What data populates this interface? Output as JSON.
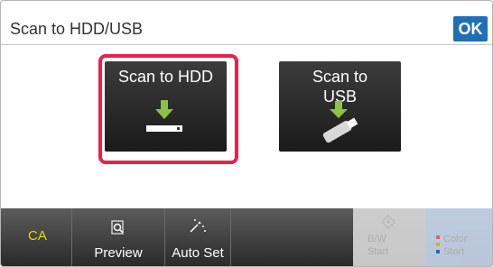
{
  "header": {
    "title": "Scan to HDD/USB",
    "ok_label": "OK"
  },
  "tiles": {
    "hdd": {
      "label": "Scan to HDD",
      "icon": "hdd-download-icon",
      "selected": true
    },
    "usb": {
      "label_line1": "Scan to",
      "label_line2": "USB",
      "icon": "usb-download-icon",
      "selected": false
    }
  },
  "toolbar": {
    "ca_label": "CA",
    "preview_label": "Preview",
    "preview_icon": "preview-magnifier-icon",
    "autoset_label": "Auto Set",
    "autoset_icon": "auto-set-wand-icon",
    "bw_label_1": "B/W",
    "bw_label_2": "Start",
    "color_label_1": "Color",
    "color_label_2": "Start"
  },
  "colors": {
    "selection_outline": "#e8214b",
    "ok_button": "#1f6fb5",
    "ca_text": "#f1d400",
    "icon_green": "#8bc34a"
  }
}
